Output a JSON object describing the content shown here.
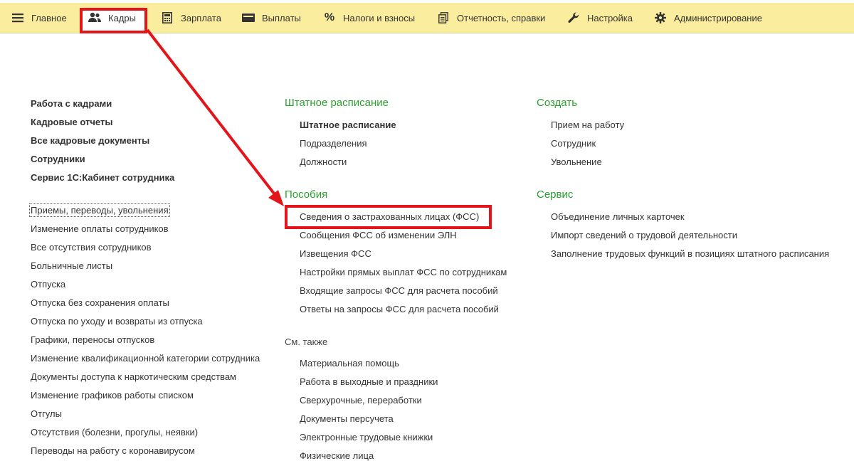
{
  "menu": {
    "items": [
      {
        "label": "Главное",
        "icon": "hamburger-icon"
      },
      {
        "label": "Кадры",
        "icon": "users-icon"
      },
      {
        "label": "Зарплата",
        "icon": "calculator-icon"
      },
      {
        "label": "Выплаты",
        "icon": "wallet-icon"
      },
      {
        "label": "Налоги и взносы",
        "icon": "percent-icon"
      },
      {
        "label": "Отчетность, справки",
        "icon": "documents-icon"
      },
      {
        "label": "Настройка",
        "icon": "wrench-icon"
      },
      {
        "label": "Администрирование",
        "icon": "gear-icon"
      }
    ]
  },
  "col1": {
    "bold": [
      "Работа с кадрами",
      "Кадровые отчеты",
      "Все кадровые документы",
      "Сотрудники",
      "Сервис 1С:Кабинет сотрудника"
    ],
    "links": [
      "Приемы, переводы, увольнения",
      "Изменение оплаты сотрудников",
      "Все отсутствия сотрудников",
      "Больничные листы",
      "Отпуска",
      "Отпуска без сохранения оплаты",
      "Отпуска по уходу и возвраты из отпуска",
      "Графики, переносы отпусков",
      "Изменение квалификационной категории сотрудника",
      "Документы доступа к наркотическим средствам",
      "Изменение графиков работы списком",
      "Отгулы",
      "Отсутствия (болезни, прогулы, неявки)",
      "Переводы на работу с коронавирусом"
    ]
  },
  "col2": {
    "shtat": {
      "title": "Штатное расписание",
      "items": [
        "Штатное расписание",
        "Подразделения",
        "Должности"
      ]
    },
    "posobiya": {
      "title": "Пособия",
      "items": [
        "Сведения о застрахованных лицах (ФСС)",
        "Сообщения ФСС об изменении ЭЛН",
        "Извещения ФСС",
        "Настройки прямых выплат ФСС по сотрудникам",
        "Входящие запросы ФСС для расчета пособий",
        "Ответы на запросы ФСС для расчета пособий"
      ]
    },
    "see_also": {
      "title": "См. также",
      "items": [
        "Материальная помощь",
        "Работа в выходные и праздники",
        "Сверхурочные, переработки",
        "Документы персучета",
        "Электронные трудовые книжки",
        "Физические лица"
      ]
    }
  },
  "col3": {
    "create": {
      "title": "Создать",
      "items": [
        "Прием на работу",
        "Сотрудник",
        "Увольнение"
      ]
    },
    "service": {
      "title": "Сервис",
      "items": [
        "Объединение личных карточек",
        "Импорт сведений о трудовой деятельности",
        "Заполнение трудовых функций в позициях штатного расписания"
      ]
    }
  },
  "colors": {
    "menubar": "#fbed9e",
    "section_header": "#2aa12e",
    "highlight": "#e3141a"
  }
}
